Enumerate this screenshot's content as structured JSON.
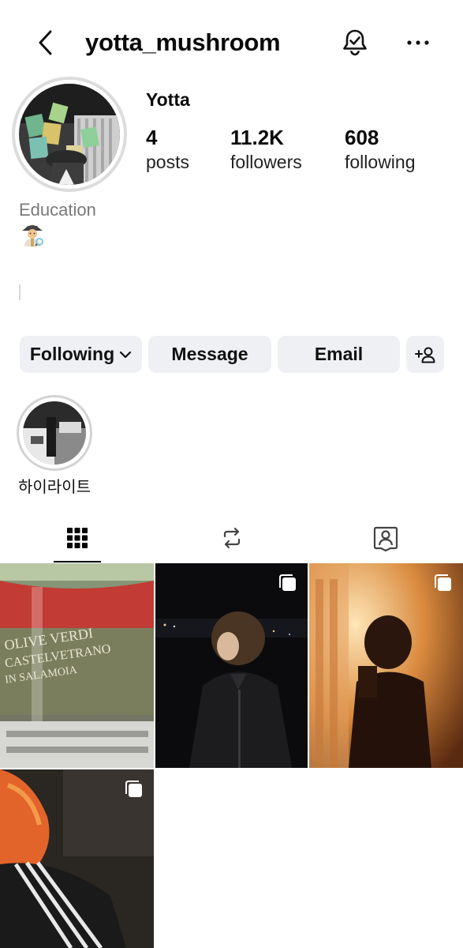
{
  "header": {
    "username": "yotta_mushroom",
    "back_icon": "chevron-left-icon",
    "bell_icon": "bell-check-icon",
    "more_icon": "more-horizontal-icon"
  },
  "profile": {
    "display_name": "Yotta",
    "stats": [
      {
        "value": "4",
        "label": "posts"
      },
      {
        "value": "11.2K",
        "label": "followers"
      },
      {
        "value": "608",
        "label": "following"
      }
    ],
    "category": "Education",
    "bio_emoji": "detective-emoji"
  },
  "actions": {
    "following_label": "Following",
    "message_label": "Message",
    "email_label": "Email"
  },
  "highlights": [
    {
      "label": "하이라이트"
    }
  ],
  "tabs": [
    "grid",
    "reels",
    "tagged"
  ],
  "posts": [
    {
      "multi": false
    },
    {
      "multi": true
    },
    {
      "multi": true
    },
    {
      "multi": true
    }
  ]
}
